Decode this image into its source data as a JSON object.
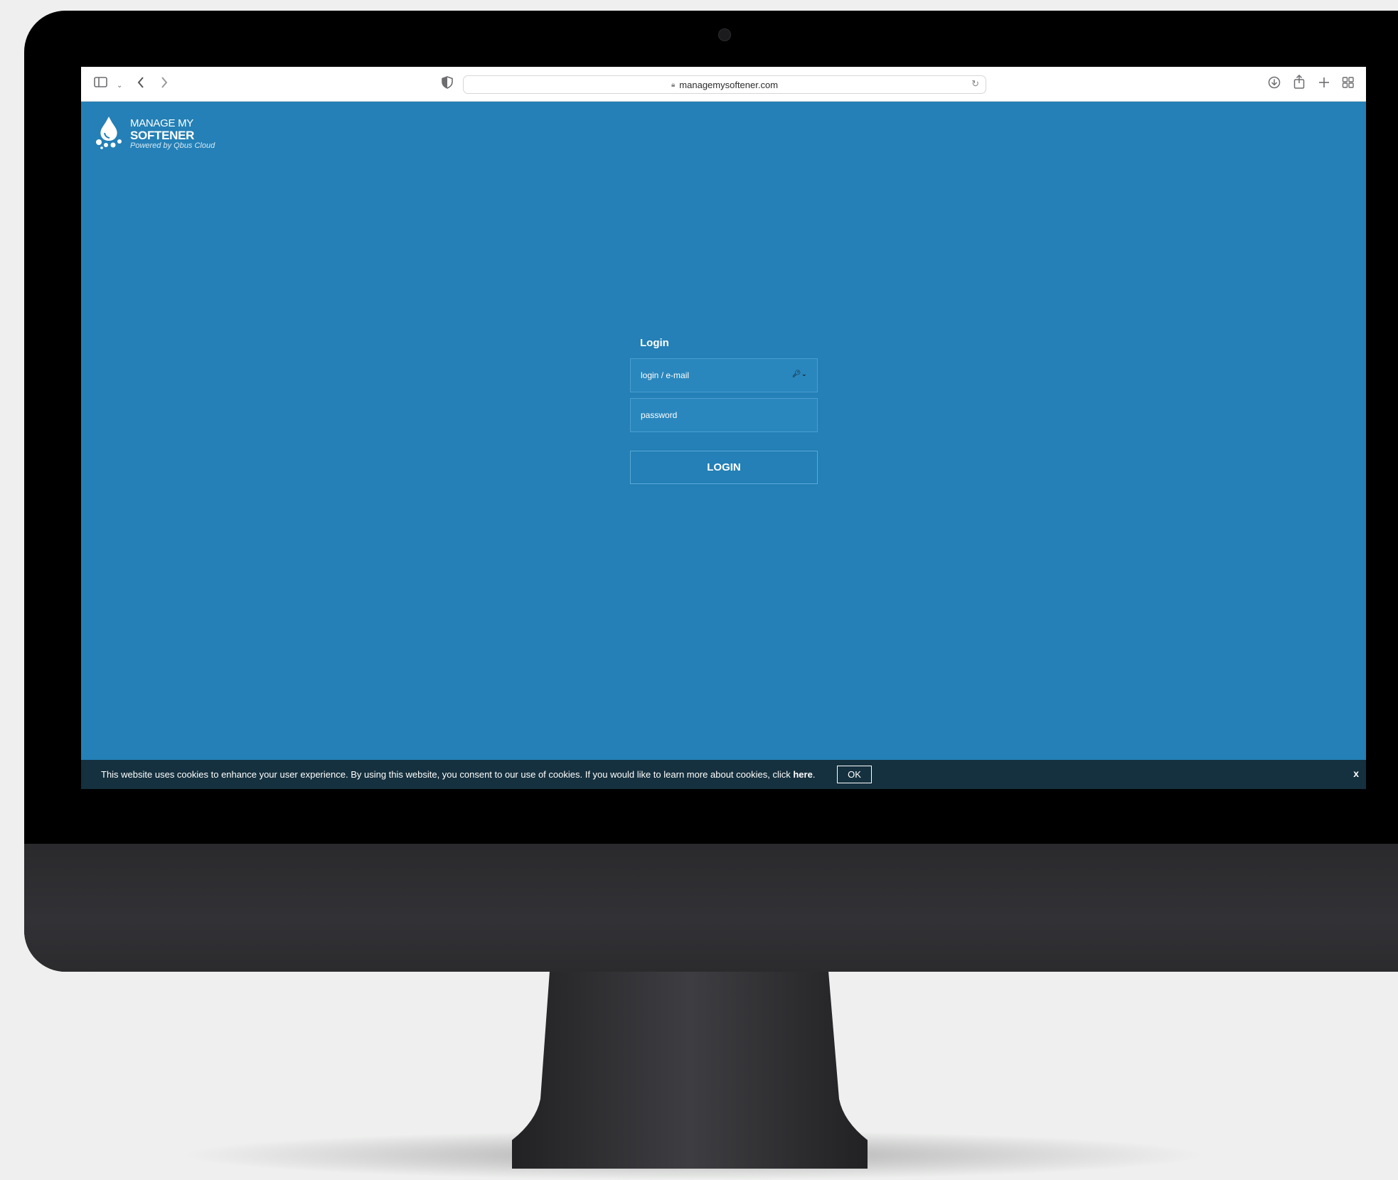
{
  "browser": {
    "url": "managemysoftener.com"
  },
  "logo": {
    "line1": "MANAGE MY",
    "line2": "SOFTENER",
    "tagline": "Powered by Qbus Cloud"
  },
  "login": {
    "title": "Login",
    "username_placeholder": "login / e-mail",
    "password_placeholder": "password",
    "button_label": "LOGIN"
  },
  "cookie_banner": {
    "text": "This website uses cookies to enhance your user experience. By using this website, you consent to our use of cookies. If you would like to learn more about cookies, click ",
    "link_label": "here",
    "suffix": ".",
    "ok_label": "OK",
    "close_label": "x"
  },
  "colors": {
    "page_background": "#2480b6",
    "cookie_background": "#15303e"
  },
  "icons": {
    "sidebar": "sidebar-icon",
    "back": "chevron-left-icon",
    "forward": "chevron-right-icon",
    "privacy": "shield-icon",
    "lock": "lock-icon",
    "reload": "reload-icon",
    "download": "download-icon",
    "share": "share-icon",
    "new_tab": "plus-icon",
    "tabs": "tab-overview-icon",
    "key": "key-icon"
  }
}
